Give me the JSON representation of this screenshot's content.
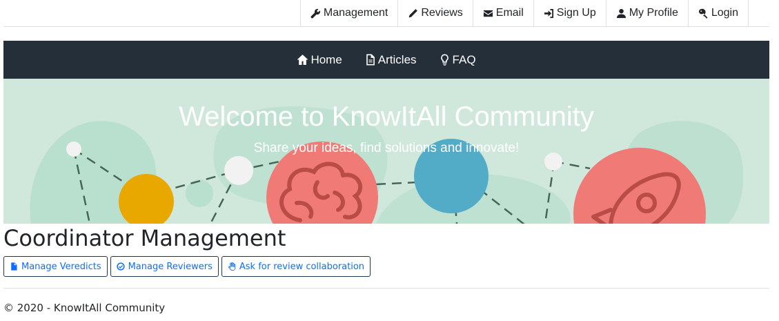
{
  "topnav": {
    "items": [
      {
        "label": "Management",
        "icon": "wrench-icon"
      },
      {
        "label": "Reviews",
        "icon": "pencil-icon"
      },
      {
        "label": "Email",
        "icon": "envelope-icon"
      },
      {
        "label": "Sign Up",
        "icon": "sign-in-icon"
      },
      {
        "label": "My Profile",
        "icon": "user-icon"
      },
      {
        "label": "Login",
        "icon": "key-icon"
      }
    ]
  },
  "mainnav": {
    "items": [
      {
        "label": "Home",
        "icon": "home-icon"
      },
      {
        "label": "Articles",
        "icon": "document-icon"
      },
      {
        "label": "FAQ",
        "icon": "lightbulb-icon"
      }
    ]
  },
  "hero": {
    "title": "Welcome to KnowItAll Community",
    "subtitle": "Share your ideas, find solutions and innovate!"
  },
  "page": {
    "title": "Coordinator Management",
    "buttons": [
      {
        "label": "Manage Veredicts",
        "icon": "file-icon"
      },
      {
        "label": "Manage Reviewers",
        "icon": "check-circle-icon"
      },
      {
        "label": "Ask for review collaboration",
        "icon": "hand-icon"
      }
    ]
  },
  "footer": {
    "text": "© 2020 - KnowItAll Community"
  },
  "colors": {
    "darknav": "#252f3a",
    "hero_bg": "#d0e8dc",
    "accent_red": "#f07a75",
    "accent_blue": "#52abc7",
    "accent_yellow": "#e8a800",
    "link": "#0d6efd"
  }
}
